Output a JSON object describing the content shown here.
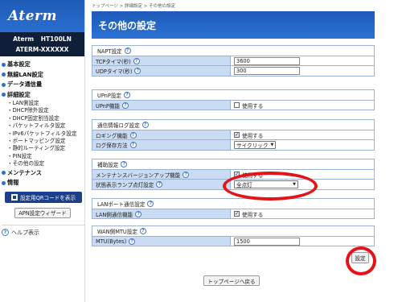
{
  "sidebar": {
    "logo": "Aterm",
    "model_name": "Aterm",
    "model_id": "HT100LN",
    "device_id": "ATERM-XXXXXX",
    "nav": [
      {
        "label": "基本設定"
      },
      {
        "label": "無線LAN設定"
      },
      {
        "label": "データ通信量"
      },
      {
        "label": "詳細設定"
      }
    ],
    "sub_items": [
      "LAN側設定",
      "DHCP除外設定",
      "DHCP固定割当設定",
      "パケットフィルタ設定",
      "IPv6パケットフィルタ設定",
      "ポートマッピング設定",
      "静的ルーティング設定",
      "PIN設定",
      "その他の設定"
    ],
    "nav_after": [
      {
        "label": "メンテナンス"
      },
      {
        "label": "情報"
      }
    ],
    "qr_button": "設定用QRコードを表示",
    "wizard_button": "APN設定ウィザード",
    "help_label": "ヘルプ表示"
  },
  "main": {
    "breadcrumb": "トップページ > 詳細設定 > その他の設定",
    "title": "その他の設定",
    "sections": {
      "napt": {
        "title": "NAPT設定",
        "tcp_label": "TCPタイマ(秒)",
        "tcp_value": "3600",
        "udp_label": "UDPタイマ(秒)",
        "udp_value": "300"
      },
      "upnp": {
        "title": "UPnP設定",
        "label": "UPnP機能",
        "check_label": "使用する",
        "checked": false
      },
      "log": {
        "title": "通信情報ログ設定",
        "logging_label": "ロギング機能",
        "logging_check": "使用する",
        "logging_checked": true,
        "save_label": "ログ保存方法",
        "save_value": "サイクリック"
      },
      "aux": {
        "title": "補助設定",
        "maint_label": "メンテナンスバージョンアップ機能",
        "maint_check": "使用する",
        "maint_checked": true,
        "lamp_label": "状態表示ランプ点灯設定",
        "lamp_value": "全点灯"
      },
      "lan_port": {
        "title": "LANポート通信設定",
        "label": "LAN側通信機能",
        "check_label": "使用する",
        "checked": true
      },
      "wan_mtu": {
        "title": "WAN側MTU設定",
        "label": "MTU(Bytes)",
        "value": "1500"
      }
    },
    "set_button": "設定",
    "top_button": "トップページへ戻る"
  },
  "colors": {
    "header_blue": "#2c72d4",
    "label_bg": "#c9dcf3",
    "highlight_ring": "#e4131a",
    "qr_button_bg": "#1c3f8a"
  }
}
